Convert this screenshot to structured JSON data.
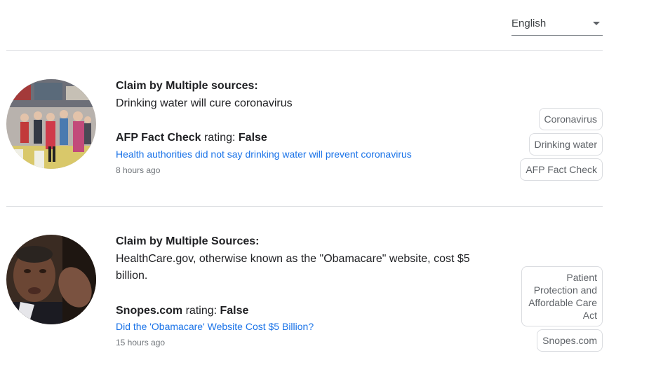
{
  "language": {
    "selected": "English"
  },
  "claims": [
    {
      "claimant": "Claim by Multiple sources:",
      "claim_text": "Drinking water will cure coronavirus",
      "publisher": "AFP Fact Check",
      "rating_word": " rating: ",
      "verdict": "False",
      "article_title": "Health authorities did not say drinking water will prevent coronavirus",
      "time_ago": "8 hours ago",
      "tags": [
        "Coronavirus",
        "Drinking water",
        "AFP Fact Check"
      ],
      "image": "crowd-wearing-masks-photo"
    },
    {
      "claimant": "Claim by Multiple Sources:",
      "claim_text": "HealthCare.gov, otherwise known as the \"Obamacare\" website, cost $5 billion.",
      "publisher": "Snopes.com",
      "rating_word": " rating: ",
      "verdict": "False",
      "article_title": "Did the 'Obamacare' Website Cost $5 Billion?",
      "time_ago": "15 hours ago",
      "tags": [
        "Patient Protection and Affordable Care Act",
        "Snopes.com"
      ],
      "image": "man-speaking-portrait-photo"
    }
  ]
}
